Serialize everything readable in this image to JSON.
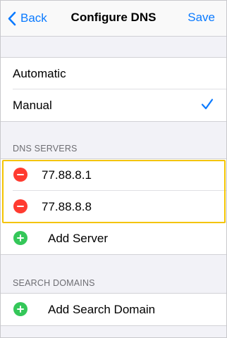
{
  "nav": {
    "back_label": "Back",
    "title": "Configure DNS",
    "save_label": "Save"
  },
  "mode": {
    "options": [
      {
        "label": "Automatic",
        "selected": false
      },
      {
        "label": "Manual",
        "selected": true
      }
    ]
  },
  "dns_servers": {
    "header": "DNS SERVERS",
    "servers": [
      "77.88.8.1",
      "77.88.8.8"
    ],
    "add_label": "Add Server"
  },
  "search_domains": {
    "header": "SEARCH DOMAINS",
    "add_label": "Add Search Domain"
  },
  "colors": {
    "accent": "#0a7aff",
    "delete": "#ff3b30",
    "add": "#34c759",
    "highlight": "#f4c400"
  },
  "icons": [
    "chevron-left-icon",
    "checkmark-icon",
    "remove-circle-icon",
    "add-circle-icon"
  ]
}
